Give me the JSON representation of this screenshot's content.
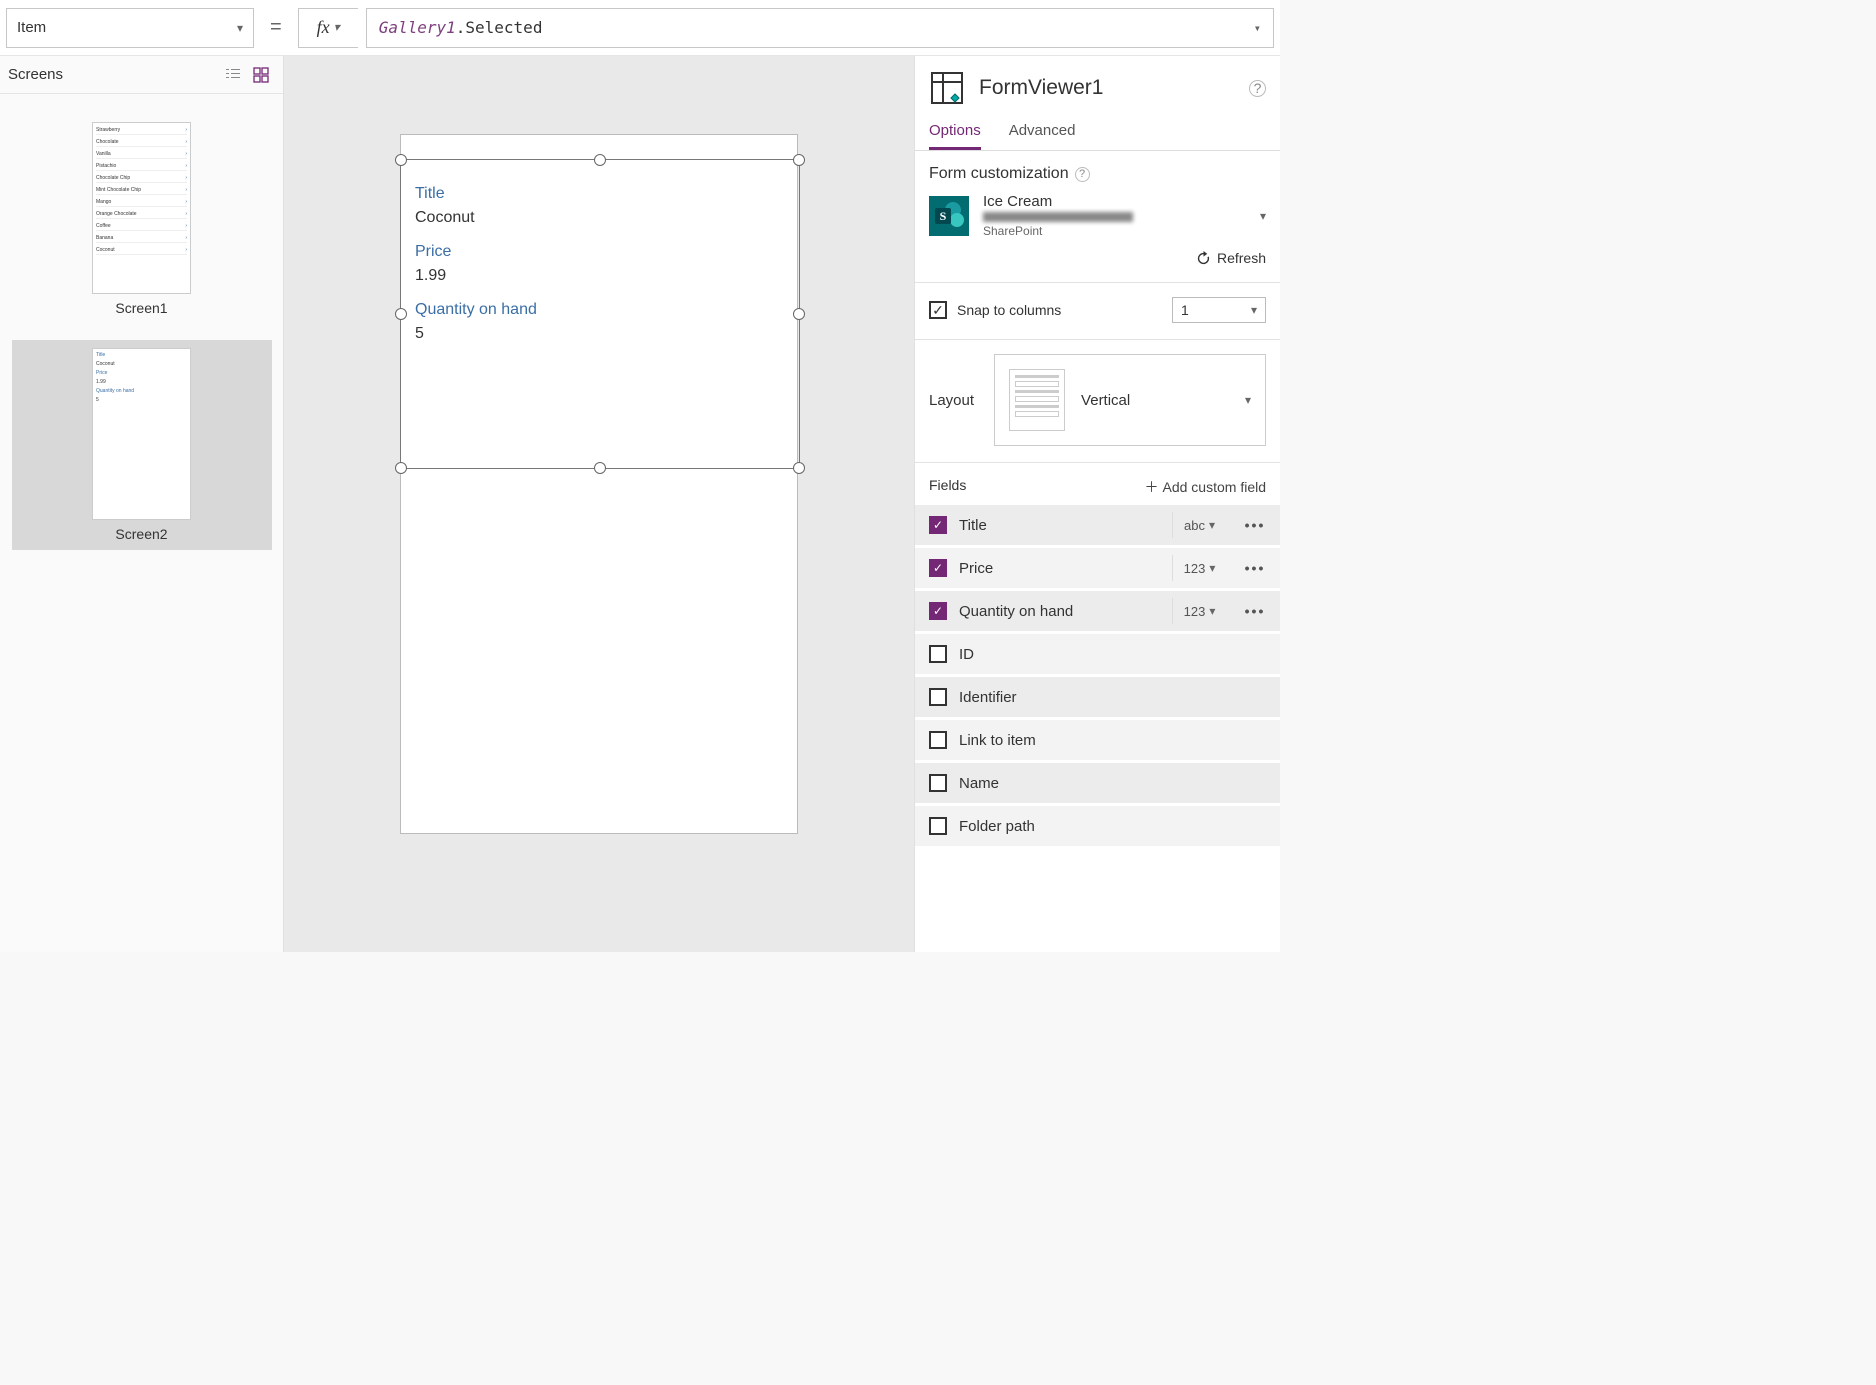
{
  "formulaBar": {
    "property": "Item",
    "eq": "=",
    "fx": "fx",
    "formulaToken1": "Gallery1",
    "formulaToken2": ".Selected"
  },
  "leftPanel": {
    "title": "Screens",
    "screens": [
      {
        "name": "Screen1"
      },
      {
        "name": "Screen2"
      }
    ],
    "thumb1Items": [
      "Strawberry",
      "Chocolate",
      "Vanilla",
      "Pistachio",
      "Chocolate Chip",
      "Mint Chocolate Chip",
      "Mango",
      "Orange Chocolate",
      "Coffee",
      "Banana",
      "Coconut"
    ],
    "thumb2": {
      "titleLabel": "Title",
      "titleVal": "Coconut",
      "priceLabel": "Price",
      "priceVal": "1.99",
      "qtyLabel": "Quantity on hand",
      "qtyVal": "5"
    }
  },
  "canvas": {
    "form": {
      "titleLabel": "Title",
      "titleValue": "Coconut",
      "priceLabel": "Price",
      "priceValue": "1.99",
      "qtyLabel": "Quantity on hand",
      "qtyValue": "5"
    }
  },
  "rightPanel": {
    "controlName": "FormViewer1",
    "tabs": {
      "options": "Options",
      "advanced": "Advanced"
    },
    "formCustomization": "Form customization",
    "dataSource": {
      "name": "Ice Cream",
      "type": "SharePoint"
    },
    "refresh": "Refresh",
    "snapToColumns": "Snap to columns",
    "columns": "1",
    "layoutLabel": "Layout",
    "layoutValue": "Vertical",
    "fieldsLabel": "Fields",
    "addCustom": "Add custom field",
    "fields": [
      {
        "name": "Title",
        "checked": true,
        "type": "abc"
      },
      {
        "name": "Price",
        "checked": true,
        "type": "123"
      },
      {
        "name": "Quantity on hand",
        "checked": true,
        "type": "123"
      },
      {
        "name": "ID",
        "checked": false,
        "type": ""
      },
      {
        "name": "Identifier",
        "checked": false,
        "type": ""
      },
      {
        "name": "Link to item",
        "checked": false,
        "type": ""
      },
      {
        "name": "Name",
        "checked": false,
        "type": ""
      },
      {
        "name": "Folder path",
        "checked": false,
        "type": ""
      }
    ]
  }
}
